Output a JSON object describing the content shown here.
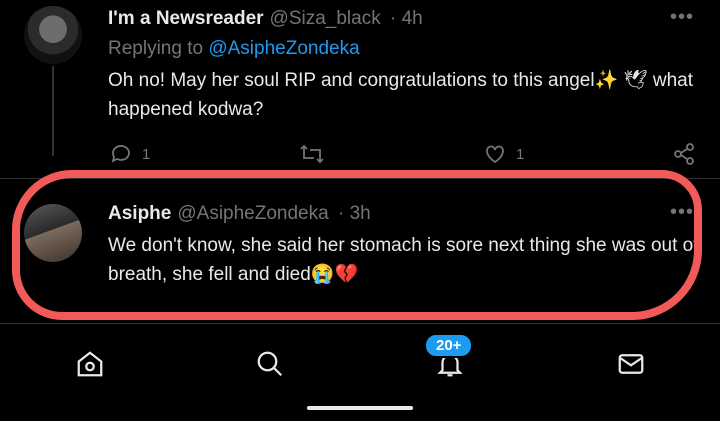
{
  "tweets": [
    {
      "name": "I'm a Newsreader",
      "handle": "@Siza_black",
      "time": "· 4h",
      "replying_prefix": "Replying to ",
      "replying_to": "@AsipheZondeka",
      "text": "Oh no! May her soul RIP and congratulations to this angel✨ 🕊 what happened kodwa?",
      "reply_count": "1",
      "like_count": "1"
    },
    {
      "name": "Asiphe",
      "handle": "@AsipheZondeka",
      "time": "· 3h",
      "text": "We don't know, she said her stomach is sore next thing she was out of breath, she fell and died😭💔"
    }
  ],
  "nav": {
    "notification_badge": "20+",
    "items": [
      "home",
      "search",
      "notifications",
      "messages"
    ]
  },
  "colors": {
    "accent": "#1d9bf0",
    "highlight": "#f25a5a",
    "muted": "#71767b",
    "background": "#000000"
  }
}
